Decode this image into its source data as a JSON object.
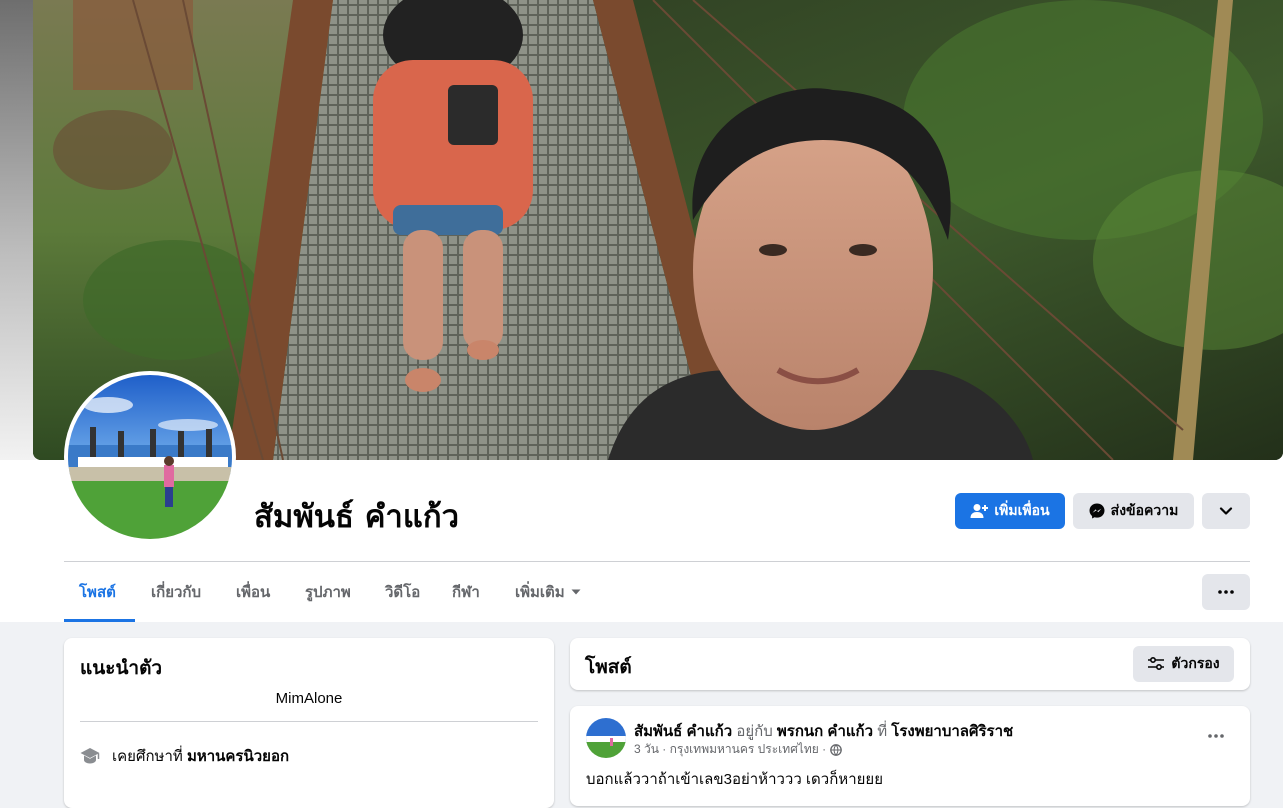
{
  "profile": {
    "name": "สัมพันธ์ คำแก้ว"
  },
  "actions": {
    "add_friend": "เพิ่มเพื่อน",
    "message": "ส่งข้อความ",
    "add_friend_icon": "add-person-icon",
    "message_icon": "messenger-icon",
    "more_icon": "chevron-down-icon"
  },
  "tabs": [
    {
      "label": "โพสต์",
      "active": true
    },
    {
      "label": "เกี่ยวกับ",
      "active": false
    },
    {
      "label": "เพื่อน",
      "active": false
    },
    {
      "label": "รูปภาพ",
      "active": false
    },
    {
      "label": "วิดีโอ",
      "active": false
    },
    {
      "label": "กีฬา",
      "active": false
    },
    {
      "label": "เพิ่มเติม",
      "active": false
    }
  ],
  "intro": {
    "title": "แนะนำตัว",
    "bio": "MimAlone",
    "education_prefix": "เคยศึกษาที่",
    "education_place": "มหานครนิวยอก",
    "education_icon": "graduation-cap-icon"
  },
  "posts": {
    "title": "โพสต์",
    "filter_label": "ตัวกรอง",
    "filter_icon": "filter-sliders-icon"
  },
  "post": {
    "author": "สัมพันธ์ คำแก้ว",
    "with_word": "อยู่กับ",
    "tagged": "พรกนก คำแก้ว",
    "at_word": "ที่",
    "place": "โรงพยาบาลศิริราช",
    "meta": "3 วัน · กรุงเทพมหานคร ประเทศไทย ·",
    "privacy_icon": "globe-icon",
    "text": "บอกแล้ววาถ้าเข้าเลข3อย่าห้าววว เดวก็หายยย"
  },
  "colors": {
    "primary": "#1b74e4",
    "secondary_button": "#e4e6eb",
    "page_background": "#f0f2f5",
    "muted_text": "#65676b"
  }
}
